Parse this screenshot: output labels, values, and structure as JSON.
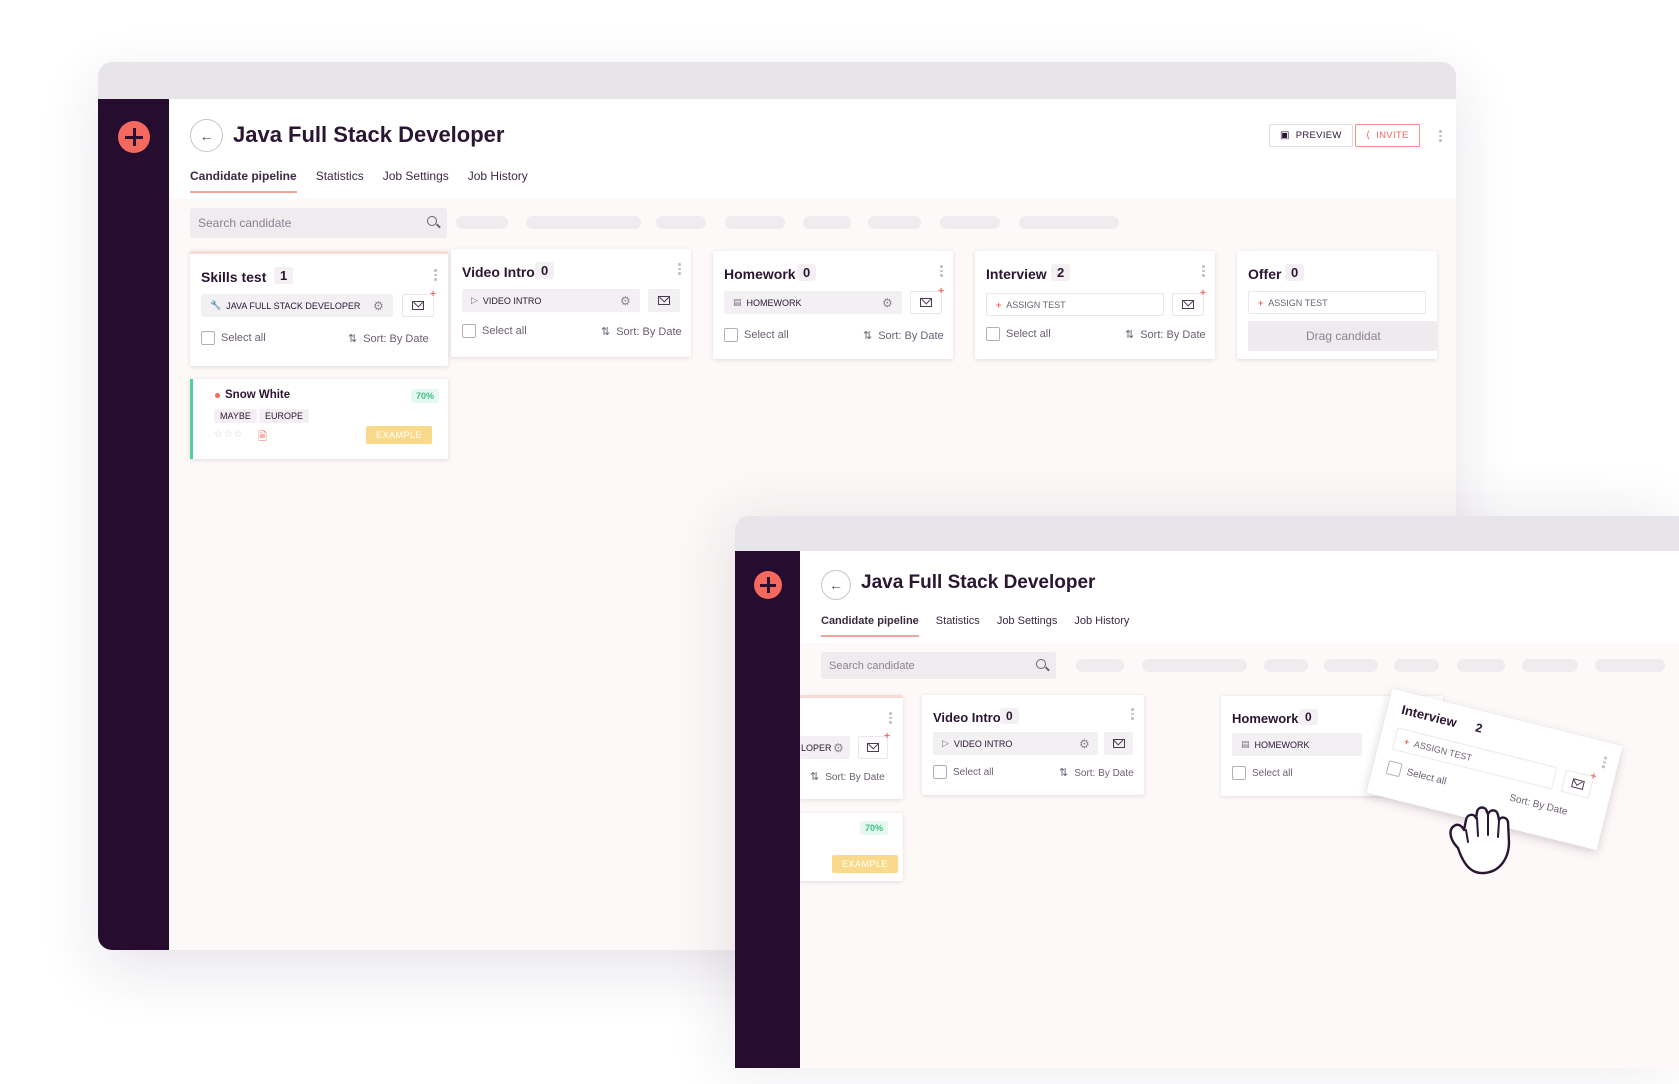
{
  "app": {
    "title": "Java Full Stack Developer",
    "tabs": [
      {
        "label": "Candidate pipeline",
        "active": true
      },
      {
        "label": "Statistics",
        "active": false
      },
      {
        "label": "Job Settings",
        "active": false
      },
      {
        "label": "Job History",
        "active": false
      }
    ],
    "preview_label": "PREVIEW",
    "invite_label": "INVITE",
    "search_placeholder": "Search candidate",
    "accent_color": "#f4685e",
    "sidebar_color": "#260c2f"
  },
  "columns": [
    {
      "name": "Skills test",
      "count": "1",
      "chip": "JAVA FULL STACK DEVELOPER",
      "chip_icon": "wrench-icon"
    },
    {
      "name": "Video Intro",
      "count": "0",
      "chip": "VIDEO INTRO",
      "chip_icon": "video-icon"
    },
    {
      "name": "Homework",
      "count": "0",
      "chip": "HOMEWORK",
      "chip_icon": "document-icon"
    },
    {
      "name": "Interview",
      "count": "2",
      "chip": "ASSIGN TEST",
      "chip_icon": "plus-icon"
    },
    {
      "name": "Offer",
      "count": "0",
      "chip": "ASSIGN TEST",
      "chip_icon": "plus-icon"
    }
  ],
  "select_all_label": "Select all",
  "sort_label": "Sort: By Date",
  "drag_label": "Drag candidat",
  "candidate": {
    "name": "Snow White",
    "score": "70%",
    "tags": [
      "MAYBE",
      "EUROPE"
    ],
    "badge": "EXAMPLE",
    "rating": 0
  },
  "second_window": {
    "partial_chip": "LOPER"
  }
}
